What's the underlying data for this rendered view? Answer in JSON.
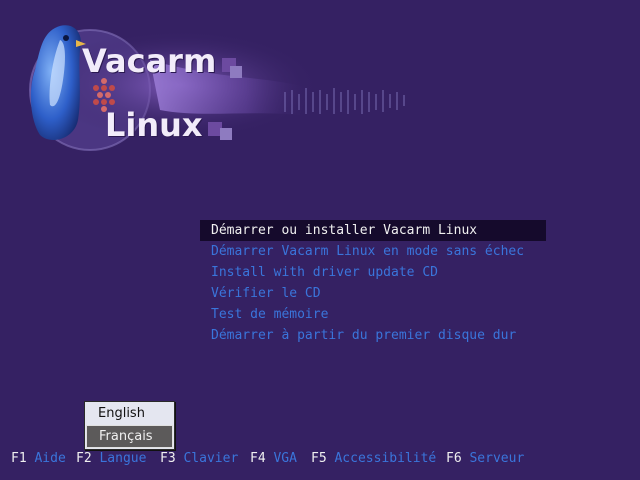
{
  "logo": {
    "line1": "Vacarm",
    "line2": "Linux"
  },
  "menu": {
    "items": [
      {
        "label": "Démarrer ou installer Vacarm Linux",
        "selected": true
      },
      {
        "label": "Démarrer Vacarm Linux en mode sans échec",
        "selected": false
      },
      {
        "label": "Install with driver update CD",
        "selected": false
      },
      {
        "label": "Vérifier le CD",
        "selected": false
      },
      {
        "label": "Test de mémoire",
        "selected": false
      },
      {
        "label": "Démarrer à partir du premier disque dur",
        "selected": false
      }
    ]
  },
  "language_popup": {
    "options": [
      {
        "label": "English",
        "selected": false
      },
      {
        "label": "Français",
        "selected": true
      }
    ]
  },
  "function_keys": [
    {
      "key": "F1",
      "label": "Aide"
    },
    {
      "key": "F2",
      "label": "Langue"
    },
    {
      "key": "F3",
      "label": "Clavier"
    },
    {
      "key": "F4",
      "label": "VGA"
    },
    {
      "key": "F5",
      "label": "Accessibilité"
    },
    {
      "key": "F6",
      "label": "Serveur"
    }
  ],
  "colors": {
    "background": "#352163",
    "menu_text": "#3a75db",
    "selected_bar": "#150a2c",
    "selected_text": "#f0f0f0"
  }
}
